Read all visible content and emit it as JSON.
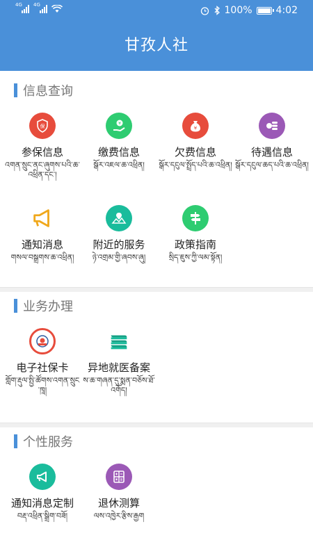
{
  "status_bar": {
    "network_1": "4G",
    "network_2": "4G",
    "battery": "100%",
    "time": "4:02"
  },
  "header": {
    "title": "甘孜人社"
  },
  "sections": [
    {
      "label": "信息查询",
      "items": [
        {
          "name": "参保信息",
          "sub": "འགན་སྲུང་ནང་ཞུགས་པའི་ཆ་འཕྲིན་དང་།",
          "icon": "insurance-shield-icon",
          "color": "#e74c3c"
        },
        {
          "name": "缴费信息",
          "sub": "སྒོར་འཇལ་ཆ་འཕྲིན།",
          "icon": "payment-hand-icon",
          "color": "#2ecc71"
        },
        {
          "name": "欠费信息",
          "sub": "སྒོར་དངུལ་སྤྲོད་པའི་ཆ་འཕྲིན།",
          "icon": "money-bag-icon",
          "color": "#e74c3c"
        },
        {
          "name": "待遇信息",
          "sub": "སྒོར་དངུལ་ཆད་པའི་ཆ་འཕྲིན།",
          "icon": "coins-stack-icon",
          "color": "#9b59b6"
        },
        {
          "name": "通知消息",
          "sub": "གསལ་བསྒྲགས་ཆ་འཕྲིན།",
          "icon": "megaphone-icon",
          "color": "#ffffff"
        },
        {
          "name": "附近的服务",
          "sub": "ཉེ་འགྲམ་གྱི་ཞབས་ཞུ།",
          "icon": "map-pin-icon",
          "color": "#1abc9c"
        },
        {
          "name": "政策指南",
          "sub": "སྲིད་ཇུས་ཀྱི་ལམ་སྟོན།",
          "icon": "signpost-icon",
          "color": "#2ecc71"
        }
      ]
    },
    {
      "label": "业务办理",
      "items": [
        {
          "name": "电子社保卡",
          "sub": "གློག་རྡུལ་སྤྱི་ཚོགས་འགན་སྲུང་ཁཱ།",
          "icon": "social-security-card-logo-icon",
          "color": "#e74c3c"
        },
        {
          "name": "异地就医备案",
          "sub": "ས་ཆ་གཞན་དུ་སྨན་བཅོས་ཐོ་འགོད།",
          "icon": "books-stack-icon",
          "color": "#16a085"
        }
      ]
    },
    {
      "label": "个性服务",
      "items": [
        {
          "name": "通知消息定制",
          "sub": "བརྡ་འཕྲིན་སྒྲིག་བཟོ།",
          "icon": "megaphone-icon",
          "color": "#1abc9c"
        },
        {
          "name": "退休测算",
          "sub": "ལས་འཁྱེར་རྩིས་རྒྱག",
          "icon": "calculator-icon",
          "color": "#9b59b6"
        }
      ]
    }
  ]
}
